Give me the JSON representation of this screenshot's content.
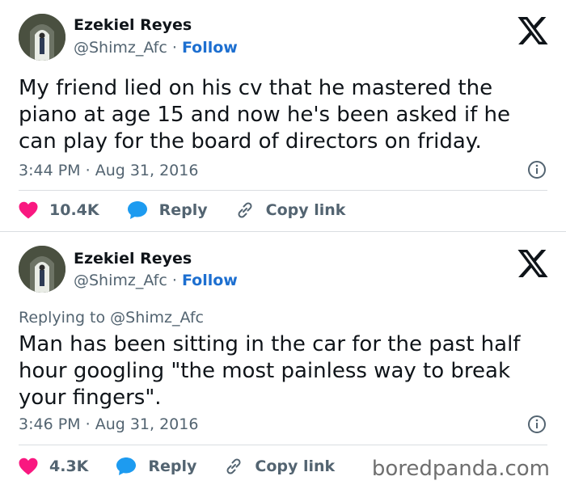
{
  "tweets": [
    {
      "name": "Ezekiel Reyes",
      "handle": "@Shimz_Afc",
      "separator": "·",
      "follow": "Follow",
      "replying_to": "",
      "text": "My friend lied on his cv that he mastered the piano at age 15 and now he's been asked if he can  play for the board of directors on friday.",
      "time": "3:44 PM",
      "date": "Aug 31, 2016",
      "likes": "10.4K",
      "reply_label": "Reply",
      "copy_label": "Copy link"
    },
    {
      "name": "Ezekiel Reyes",
      "handle": "@Shimz_Afc",
      "separator": "·",
      "follow": "Follow",
      "replying_to": "Replying to @Shimz_Afc",
      "text": "Man has been sitting in the car for the past half hour googling \"the most painless way to break your fingers\".",
      "time": "3:46 PM",
      "date": "Aug 31, 2016",
      "likes": "4.3K",
      "reply_label": "Reply",
      "copy_label": "Copy link"
    }
  ],
  "watermark": "boredpanda.com",
  "colors": {
    "accent": "#1d6fd0",
    "heart": "#f91880",
    "reply_bubble": "#1d9bf0",
    "muted": "#536471"
  },
  "icons": [
    "x-logo-icon",
    "info-icon",
    "heart-icon",
    "reply-bubble-icon",
    "link-icon"
  ]
}
